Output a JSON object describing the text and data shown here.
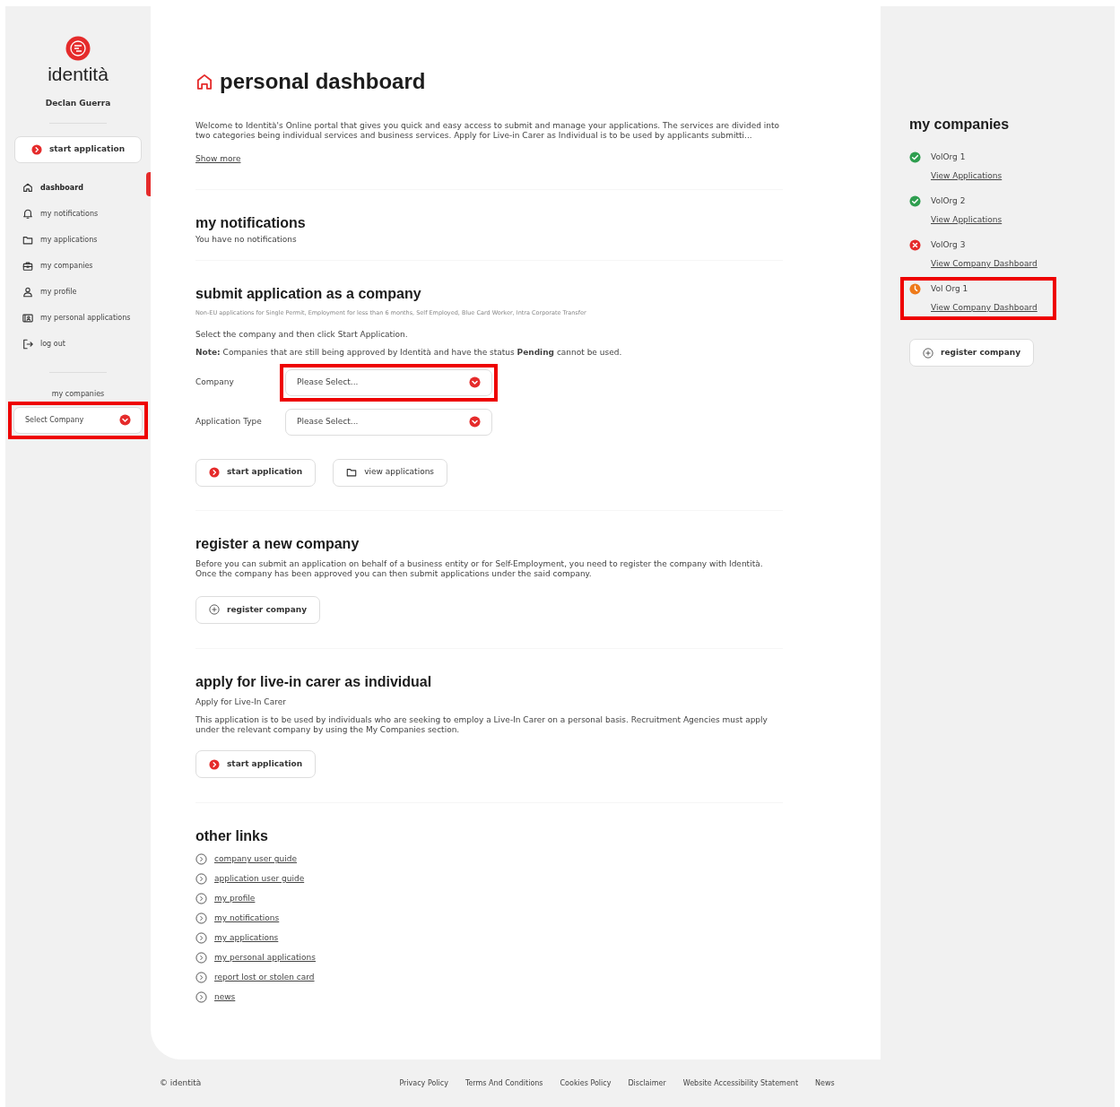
{
  "sidebar": {
    "logo_text": "identità",
    "user_name": "Declan Guerra",
    "start_button": "start application",
    "nav": [
      {
        "label": "dashboard",
        "selected": true
      },
      {
        "label": "my notifications",
        "selected": false
      },
      {
        "label": "my applications",
        "selected": false
      },
      {
        "label": "my companies",
        "selected": false
      },
      {
        "label": "my profile",
        "selected": false
      },
      {
        "label": "my personal applications",
        "selected": false
      },
      {
        "label": "log out",
        "selected": false
      }
    ],
    "companies_label": "my companies",
    "company_select": {
      "placeholder": "Select Company",
      "highlighted": true
    }
  },
  "main": {
    "title": "personal dashboard",
    "intro": "Welcome to Identità's Online portal that gives you quick and easy access to submit and manage your applications. The services are divided into two categories being individual services and business services. Apply for Live-in Carer as Individual is to be used by applicants submitti...",
    "show_more": "Show more",
    "notifications": {
      "title": "my notifications",
      "message": "You have no notifications"
    },
    "submit": {
      "title": "submit application as a company",
      "subtitle": "Non-EU applications for Single Permit, Employment for less than 6 months, Self Employed, Blue Card Worker, Intra Corporate Transfer",
      "instruction": "Select the company and then click Start Application.",
      "note": "**Note:** Companies that are still being approved by Identità and have the status **Pending** cannot be used.",
      "fields": [
        {
          "label": "Company",
          "placeholder": "Please Select...",
          "highlighted": true
        },
        {
          "label": "Application Type",
          "placeholder": "Please Select...",
          "highlighted": false
        }
      ],
      "buttons": [
        {
          "label": "start application",
          "kind": "start"
        },
        {
          "label": "view applications",
          "kind": "folder"
        }
      ]
    },
    "register": {
      "title": "register a new company",
      "text": "Before you can submit an application on behalf of a business entity or for Self-Employment, you need to register the company with Identità. Once the company has been approved you can then submit applications under the said company.",
      "button": "register company"
    },
    "carer": {
      "title": "apply for live-in carer as individual",
      "subtitle": "Apply for Live-In Carer",
      "text": "This application is to be used by individuals who are seeking to employ a Live-In Carer on a personal basis. Recruitment Agencies must apply under the relevant company by using the My Companies section.",
      "button": "start application"
    },
    "other_links": {
      "title": "other links",
      "links": [
        "company user guide",
        "application user guide",
        "my profile",
        "my notifications",
        "my applications",
        "my personal applications",
        "report lost or stolen card",
        "news"
      ]
    }
  },
  "companies": {
    "title": "my companies",
    "items": [
      {
        "name": "VolOrg 1",
        "kind": "approved",
        "link": "View Applications",
        "highlighted": false
      },
      {
        "name": "VolOrg 2",
        "kind": "approved",
        "link": "View Applications",
        "highlighted": false
      },
      {
        "name": "VolOrg 3",
        "kind": "rejected",
        "link": "View Company Dashboard",
        "highlighted": false
      },
      {
        "name": "Vol Org 1",
        "kind": "pending",
        "link": "View Company Dashboard",
        "highlighted": true
      }
    ],
    "button": "register company"
  },
  "footer": {
    "copyright": "© identità",
    "links": [
      "Privacy Policy",
      "Terms And Conditions",
      "Cookies Policy",
      "Disclaimer",
      "Website Accessibility Statement",
      "News"
    ]
  }
}
